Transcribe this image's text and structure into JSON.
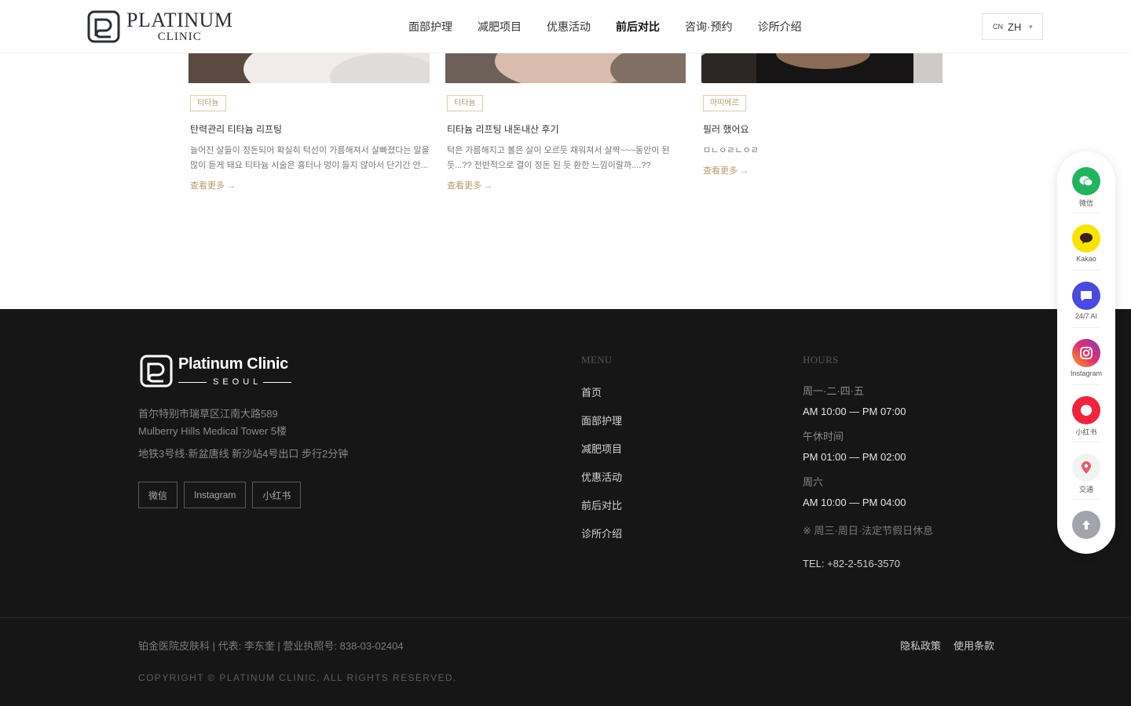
{
  "header": {
    "logo_line1": "PLATINUM",
    "logo_line2": "CLINIC",
    "nav": [
      "面部护理",
      "减肥项目",
      "优惠活动",
      "前后对比",
      "咨询·预约",
      "诊所介绍"
    ],
    "active_nav": "前后对比",
    "lang_code": "CN",
    "lang_label": "ZH"
  },
  "cards": [
    {
      "tag": "티타늄",
      "title": "탄력관리 티타늄 리프팅",
      "desc": "늘어진 살들이 정돈되어 확실히 턱선이 가름해져서 살빠졌다는 말을 많이 듣게 돼요 티타늄 시술은 흉터나 멍이 들지 않아서 단기간 안...",
      "more": "查看更多 →"
    },
    {
      "tag": "티타늄",
      "title": "티타늄 리프팅 내돈내산 후기",
      "desc": "턱은 가름해지고 볼은 살이 오르듯 채워져서 살짝~~~동안이 된 듯...?? 전반적으로 결이 정돈 된 듯 환한 느낌이랄까....??",
      "more": "查看更多 →"
    },
    {
      "tag": "아띠에르",
      "title": "필러 했어요",
      "desc": "ㅁㄴㅇㄹㄴㅇㄹ",
      "more": "查看更多 →"
    }
  ],
  "footer": {
    "logo_title": "Platinum Clinic",
    "logo_sub": "SEOUL",
    "address_line1": "首尔特别市瑞草区江南大路589",
    "address_line2": "Mulberry Hills Medical Tower 5楼",
    "subway": "地铁3号线·新盆唐线 新沙站4号出口 步行2分钟",
    "social": [
      "微信",
      "Instagram",
      "小红书"
    ],
    "menu_heading": "MENU",
    "menu": [
      "首页",
      "面部护理",
      "减肥项目",
      "优惠活动",
      "前后对比",
      "诊所介绍"
    ],
    "hours_heading": "HOURS",
    "hours": [
      {
        "label": "周一·二·四·五",
        "value": "AM 10:00 — PM 07:00"
      },
      {
        "label": "午休时间",
        "value": "PM 01:00 — PM 02:00"
      },
      {
        "label": "周六",
        "value": "AM 10:00 — PM 04:00"
      }
    ],
    "hours_note": "※ 周三·周日·法定节假日休息",
    "tel": "TEL: +82-2-516-3570",
    "business_info": "铂金医院皮肤科 | 代表: 李东奎 | 营业执照号: 838-03-02404",
    "legal": [
      "隐私政策",
      "使用条款"
    ],
    "copyright": "COPYRIGHT © PLATINUM CLINIC. ALL RIGHTS RESERVED."
  },
  "float_bar": {
    "items": [
      {
        "label": "微信",
        "icon": "wechat-icon",
        "color": "#22b35e"
      },
      {
        "label": "Kakao",
        "icon": "kakao-icon",
        "color": "#fbe300"
      },
      {
        "label": "24/7 AI",
        "icon": "chat-icon",
        "color": "#4a4ae0"
      },
      {
        "label": "Instagram",
        "icon": "instagram-icon",
        "color": "#d6336c"
      },
      {
        "label": "小红书",
        "icon": "xiaohongshu-icon",
        "color": "#f0243c"
      },
      {
        "label": "交通",
        "icon": "location-pin-icon",
        "color": "#f3f3f3"
      }
    ],
    "top_icon": "arrow-up-icon",
    "top_color": "#a3a3ab"
  },
  "colors": {
    "accent_gold": "#b69d6f",
    "footer_bg": "#171617"
  }
}
